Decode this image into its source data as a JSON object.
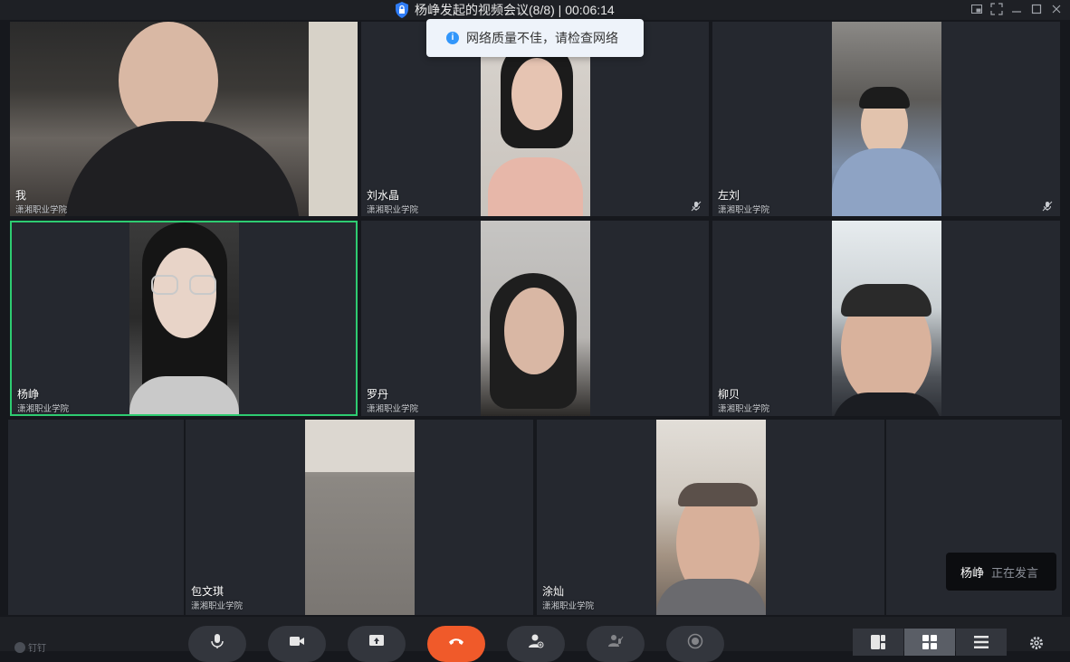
{
  "window": {
    "title": "杨峥发起的视频会议(8/8) | 00:06:14",
    "controls": [
      "pip-icon",
      "fullscreen-icon",
      "minimize-icon",
      "maximize-icon",
      "close-icon"
    ]
  },
  "toast": {
    "message": "网络质量不佳，请检查网络",
    "icon": "info-icon"
  },
  "participants": [
    {
      "name": "我",
      "org": "潇湘职业学院",
      "muted": false,
      "active": false
    },
    {
      "name": "刘水晶",
      "org": "潇湘职业学院",
      "muted": true,
      "active": false
    },
    {
      "name": "左刘",
      "org": "潇湘职业学院",
      "muted": true,
      "active": false
    },
    {
      "name": "杨峥",
      "org": "潇湘职业学院",
      "muted": false,
      "active": true
    },
    {
      "name": "罗丹",
      "org": "潇湘职业学院",
      "muted": false,
      "active": false
    },
    {
      "name": "柳贝",
      "org": "潇湘职业学院",
      "muted": false,
      "active": false
    },
    {
      "name": "包文琪",
      "org": "潇湘职业学院",
      "muted": false,
      "active": false
    },
    {
      "name": "涂灿",
      "org": "潇湘职业学院",
      "muted": false,
      "active": false
    }
  ],
  "speaking": {
    "name": "杨峥",
    "status": "正在发言"
  },
  "bottom": {
    "brand": "钉钉",
    "controls": [
      "microphone-icon",
      "camera-icon",
      "screen-share-icon",
      "hang-up-icon",
      "add-member-icon",
      "mute-all-icon",
      "record-icon"
    ],
    "layouts": [
      "speaker-layout-icon",
      "grid-layout-icon",
      "list-layout-icon"
    ],
    "settings": "gear-icon"
  },
  "colors": {
    "active_border": "#2ecc71",
    "hang_up": "#f05a2a",
    "info": "#3296fa",
    "tile_bg": "#25282f"
  }
}
